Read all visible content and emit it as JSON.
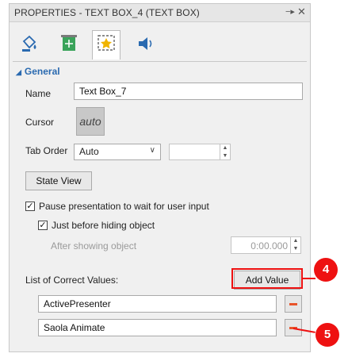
{
  "panel": {
    "title": "PROPERTIES - TEXT BOX_4 (TEXT BOX)",
    "pin_icon": "pin-icon",
    "close_icon": "close-icon"
  },
  "tabs": [
    {
      "name": "fill-icon",
      "active": false
    },
    {
      "name": "size-position-icon",
      "active": false
    },
    {
      "name": "interactivity-icon",
      "active": true
    },
    {
      "name": "audio-icon",
      "active": false
    }
  ],
  "general": {
    "section_label": "General",
    "name_label": "Name",
    "name_value": "Text Box_7",
    "cursor_label": "Cursor",
    "cursor_value": "auto",
    "tab_order_label": "Tab Order",
    "tab_order_value": "Auto",
    "state_view_label": "State View",
    "pause_label": "Pause presentation to wait for user input",
    "pause_checked": true,
    "hide_label": "Just before hiding object",
    "hide_checked": true,
    "after_showing_label": "After showing object",
    "after_showing_value": "0:00.000"
  },
  "correct_values": {
    "label": "List of Correct Values:",
    "add_button": "Add Value",
    "items": [
      "ActivePresenter",
      "Saola Animate"
    ]
  },
  "annotations": {
    "badge_4": "4",
    "badge_5": "5",
    "color": "#e11111"
  }
}
